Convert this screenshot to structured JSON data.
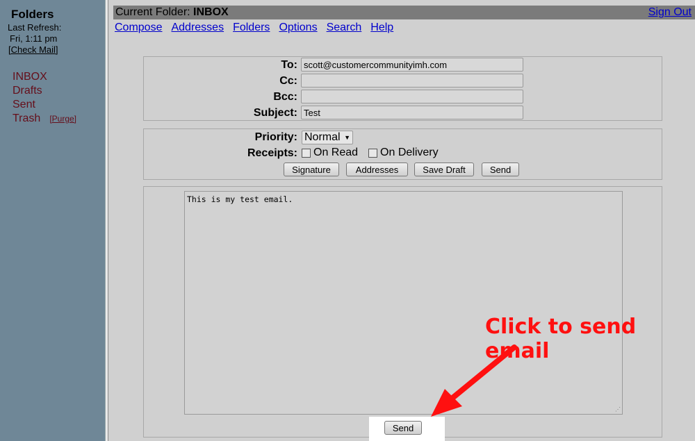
{
  "sidebar": {
    "title": "Folders",
    "last_refresh_label": "Last Refresh:",
    "last_refresh_time": "Fri, 1:11 pm",
    "check_mail": "[Check Mail]",
    "folders": [
      {
        "label": "INBOX"
      },
      {
        "label": "Drafts"
      },
      {
        "label": "Sent"
      },
      {
        "label": "Trash",
        "action": "[Purge]"
      }
    ]
  },
  "header": {
    "current_folder_label": "Current Folder:",
    "current_folder": "INBOX",
    "sign_out": "Sign Out"
  },
  "nav": [
    "Compose",
    "Addresses",
    "Folders",
    "Options",
    "Search",
    "Help"
  ],
  "compose": {
    "to_label": "To:",
    "to_value": "scott@customercommunityimh.com",
    "cc_label": "Cc:",
    "cc_value": "",
    "bcc_label": "Bcc:",
    "bcc_value": "",
    "subject_label": "Subject:",
    "subject_value": "Test",
    "priority_label": "Priority:",
    "priority_value": "Normal",
    "receipts_label": "Receipts:",
    "receipt_on_read": "On Read",
    "receipt_on_delivery": "On Delivery",
    "buttons": {
      "signature": "Signature",
      "addresses": "Addresses",
      "save_draft": "Save Draft",
      "send": "Send"
    },
    "body": "This is my test email.",
    "bottom_send": "Send"
  },
  "annotation": {
    "text": "Click to send email",
    "color": "#ff1010"
  }
}
